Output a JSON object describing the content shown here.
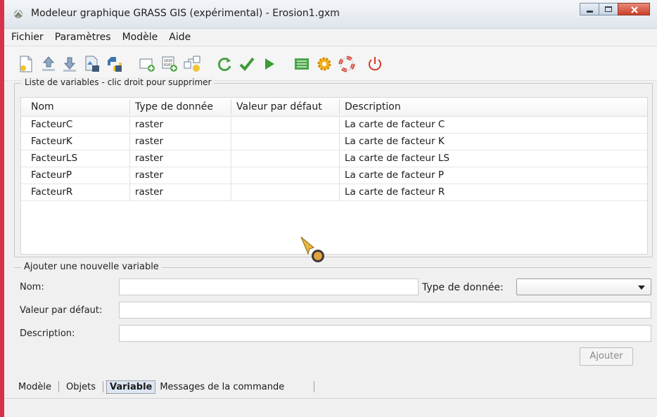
{
  "window": {
    "title": "Modeleur graphique GRASS GIS (expérimental) - Erosion1.gxm"
  },
  "menu": [
    "Fichier",
    "Paramètres",
    "Modèle",
    "Aide"
  ],
  "toolbar_icons": [
    "new-model-icon",
    "open-model-icon",
    "save-model-icon",
    "export-image-icon",
    "export-python-icon",
    "add-command-icon",
    "add-data-icon",
    "add-relation-icon",
    "redraw-icon",
    "validate-icon",
    "run-icon",
    "variables-icon",
    "settings-icon",
    "help-icon",
    "quit-icon"
  ],
  "variables": {
    "legend": "Liste de variables - clic droit pour supprimer",
    "columns": [
      "Nom",
      "Type de donnée",
      "Valeur par défaut",
      "Description"
    ],
    "rows": [
      [
        "FacteurC",
        "raster",
        "",
        "La carte de facteur C"
      ],
      [
        "FacteurK",
        "raster",
        "",
        "La carte de facteur K"
      ],
      [
        "FacteurLS",
        "raster",
        "",
        "La carte de facteur LS"
      ],
      [
        "FacteurP",
        "raster",
        "",
        "La carte de facteur P"
      ],
      [
        "FacteurR",
        "raster",
        "",
        "La carte de facteur R"
      ]
    ]
  },
  "add_variable": {
    "legend": "Ajouter une nouvelle variable",
    "name_label": "Nom:",
    "type_label": "Type de donnée:",
    "default_label": "Valeur par défaut:",
    "description_label": "Description:",
    "name_value": "",
    "type_value": "",
    "default_value": "",
    "description_value": "",
    "add_button": "Ajouter"
  },
  "tabs": [
    "Modèle",
    "Objets",
    "Variable",
    "Messages de la commande"
  ],
  "active_tab": "Variable"
}
